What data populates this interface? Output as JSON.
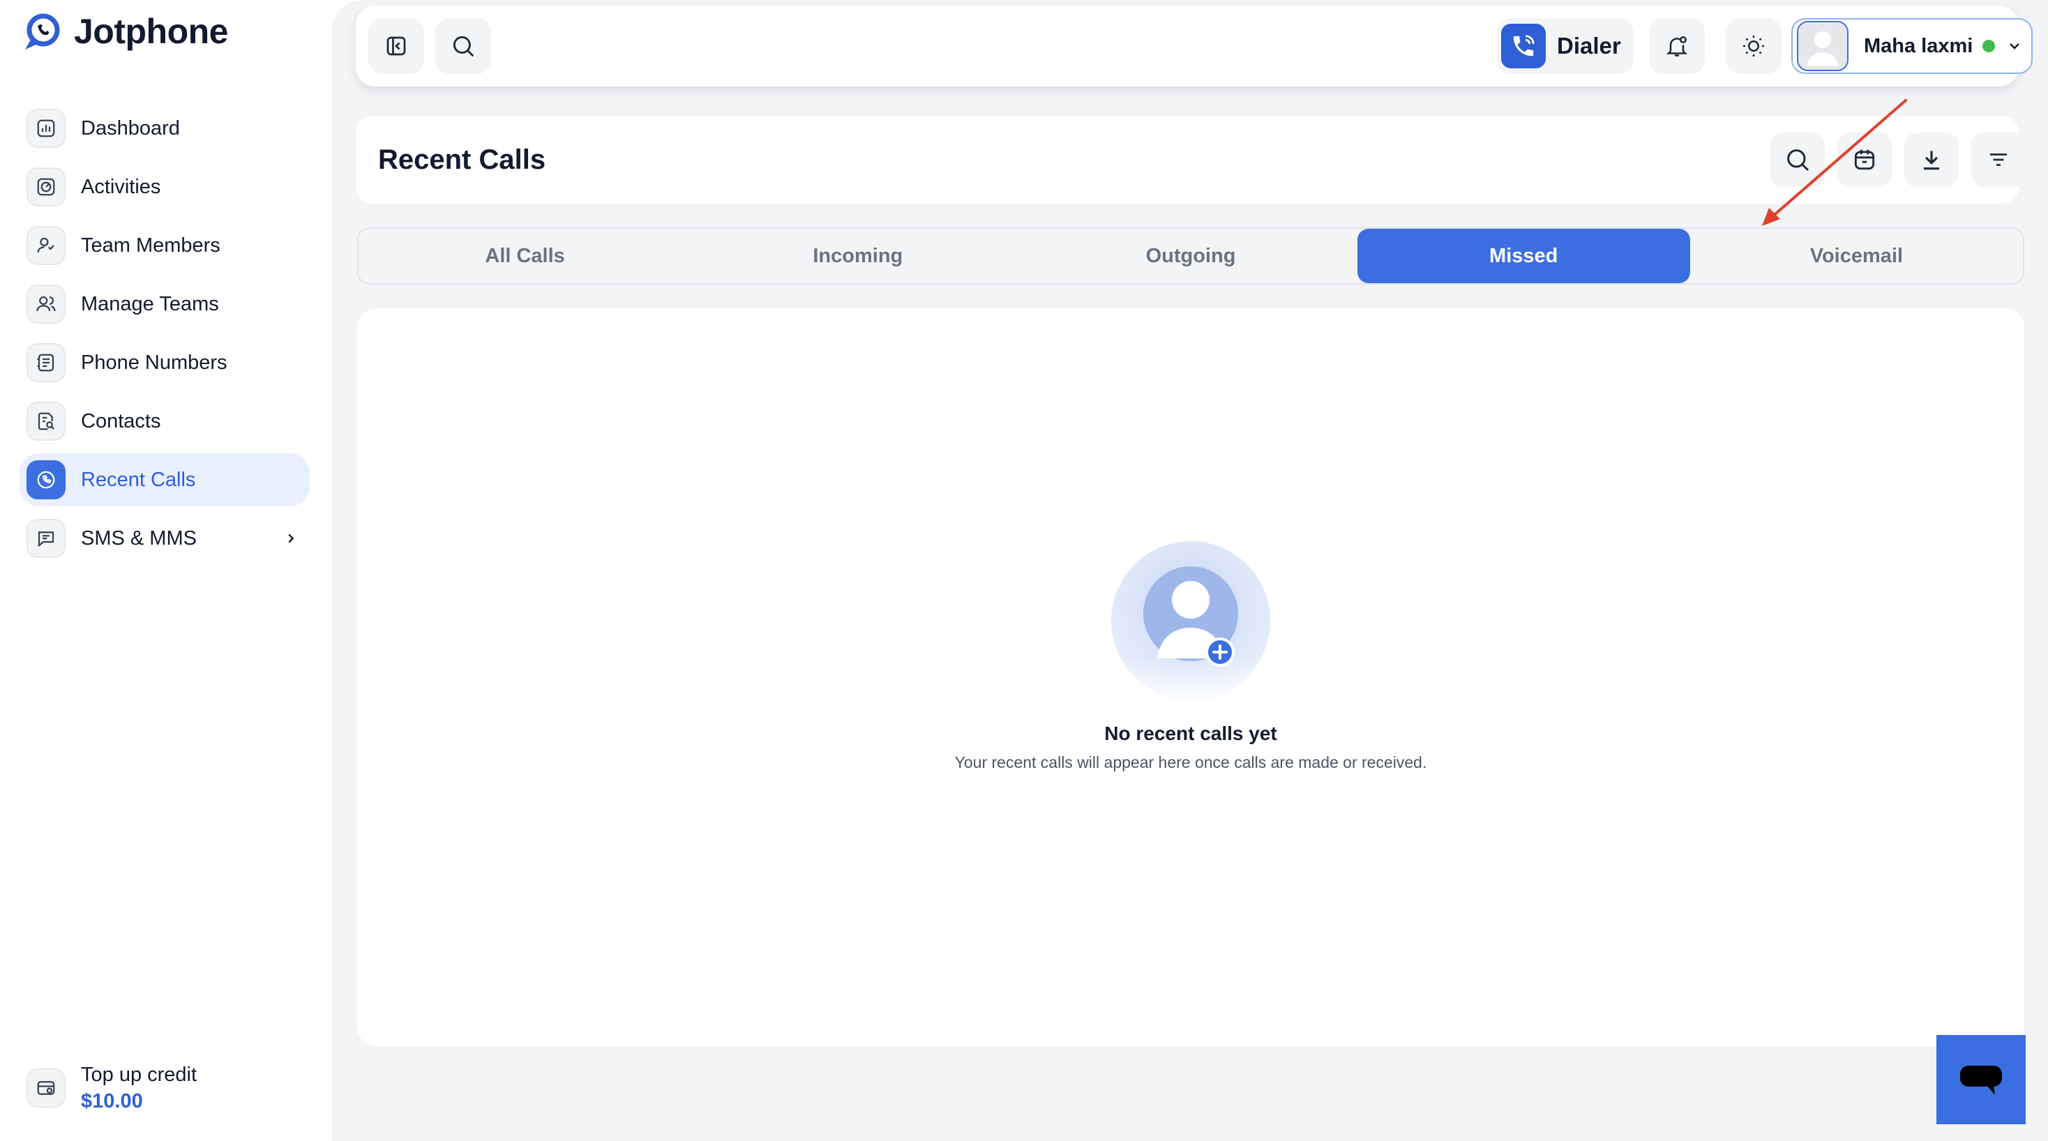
{
  "brand": {
    "name": "Jotphone"
  },
  "sidebar": {
    "items": [
      {
        "label": "Dashboard",
        "icon": "chart-icon"
      },
      {
        "label": "Activities",
        "icon": "activity-icon"
      },
      {
        "label": "Team Members",
        "icon": "user-icon"
      },
      {
        "label": "Manage Teams",
        "icon": "users-icon"
      },
      {
        "label": "Phone Numbers",
        "icon": "phone-book-icon"
      },
      {
        "label": "Contacts",
        "icon": "contacts-icon"
      },
      {
        "label": "Recent Calls",
        "icon": "phone-icon",
        "active": true
      },
      {
        "label": "SMS & MMS",
        "icon": "message-icon"
      }
    ],
    "topup": {
      "label": "Top up credit",
      "amount": "$10.00"
    }
  },
  "topbar": {
    "dialer_label": "Dialer",
    "user_name": "Maha laxmi",
    "user_status": "online"
  },
  "page": {
    "title": "Recent Calls"
  },
  "tabs": [
    {
      "label": "All Calls"
    },
    {
      "label": "Incoming"
    },
    {
      "label": "Outgoing"
    },
    {
      "label": "Missed",
      "active": true
    },
    {
      "label": "Voicemail"
    }
  ],
  "empty_state": {
    "title": "No recent calls yet",
    "subtitle": "Your recent calls will appear here once calls are made or received."
  },
  "colors": {
    "accent": "#3b6fe0",
    "accent_text": "#2f5fd6",
    "status_online": "#3fb950",
    "annotation_arrow": "#e0402c"
  }
}
